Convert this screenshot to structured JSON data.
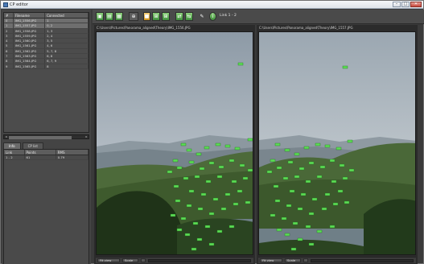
{
  "window": {
    "title": "CP editor",
    "controls": [
      "–",
      "□",
      "✕"
    ]
  },
  "image_list": {
    "columns": [
      "#",
      "Filename",
      "Connected"
    ],
    "rows": [
      [
        "0",
        "IMG_1556.JPG",
        "1"
      ],
      [
        "1",
        "IMG_1557.JPG",
        "0, 2"
      ],
      [
        "2",
        "IMG_1558.JPG",
        "1, 3"
      ],
      [
        "3",
        "IMG_1559.JPG",
        "2, 4"
      ],
      [
        "4",
        "IMG_1560.JPG",
        "3, 5"
      ],
      [
        "5",
        "IMG_1561.JPG",
        "4, 6"
      ],
      [
        "6",
        "IMG_1562.JPG",
        "5, 7, 8"
      ],
      [
        "7",
        "IMG_1563.JPG",
        "6, 8"
      ],
      [
        "8",
        "IMG_1564.JPG",
        "6, 7, 9"
      ],
      [
        "9",
        "IMG_1565.JPG",
        "8"
      ]
    ]
  },
  "tabs": [
    "Info",
    "CP list"
  ],
  "group_table": {
    "columns": [
      "Link",
      "Points",
      "RMS"
    ],
    "rows": [
      [
        "1 - 2",
        "61",
        "0.79"
      ]
    ]
  },
  "toolbar": {
    "label": "Link 1 - 2"
  },
  "left_pane": {
    "path": "C:\\Users\\Pictures\\Panorama_aligned\\Theory\\IMG_1556.JPG",
    "zoom": "Fit view",
    "option": "Scale"
  },
  "right_pane": {
    "path": "C:\\Users\\Pictures\\Panorama_aligned\\Theory\\IMG_1557.JPG",
    "zoom": "Fit view",
    "option": "Scale"
  },
  "colors": {
    "accent": "#3fae3a",
    "marker": "#6fe36a",
    "panel": "#444444"
  },
  "icons": [
    "app-icon",
    "fit-icon",
    "zoom-icon",
    "grid-icon",
    "cp-icon",
    "settings-icon",
    "info-icon"
  ]
}
